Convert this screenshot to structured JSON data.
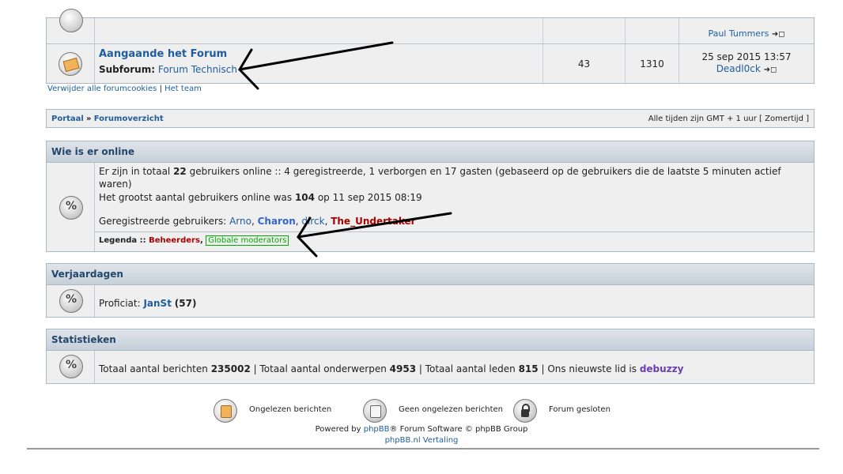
{
  "forum_table": {
    "row1": {
      "last_user": "Paul Tummers"
    },
    "row2": {
      "title": "Aangaande het Forum",
      "subforum_label": "Subforum:",
      "subforum_link": "Forum Technisch",
      "topics": "43",
      "posts": "1310",
      "last_date": "25 sep 2015 13:57",
      "last_user": "Deadl0ck"
    }
  },
  "links": {
    "delete_cookies": "Verwijder alle forumcookies",
    "sep": "|",
    "team": "Het team"
  },
  "breadcrumb": {
    "portal": "Portaal",
    "sep": "»",
    "overview": "Forumoverzicht",
    "timezone": "Alle tijden zijn GMT + 1 uur [ Zomertijd ]"
  },
  "online": {
    "header": "Wie is er online",
    "line1_a": "Er zijn in totaal ",
    "line1_num": "22",
    "line1_b": " gebruikers online :: 4 geregistreerde, 1 verborgen en 17 gasten (gebaseerd op de gebruikers die de laatste 5 minuten actief",
    "line2": "waren)",
    "line3_a": "Het grootst aantal gebruikers online was ",
    "line3_num": "104",
    "line3_b": " op 11 sep 2015 08:19",
    "registered_label": "Geregistreerde gebruikers: ",
    "users": [
      "Arno",
      "Charon",
      "dirck",
      "The_Undertaker"
    ],
    "legend_label": "Legenda :: ",
    "legend_admins": "Beheerders",
    "legend_mods": "Globale moderators"
  },
  "birthdays": {
    "header": "Verjaardagen",
    "text": "Proficiat: ",
    "user": "JanSt",
    "age": "(57)"
  },
  "stats": {
    "header": "Statistieken",
    "a": "Totaal aantal berichten ",
    "posts": "235002",
    "b": " | Totaal aantal onderwerpen ",
    "topics": "4953",
    "c": " | Totaal aantal leden ",
    "members": "815",
    "d": " | Ons nieuwste lid is ",
    "newest": "debuzzy"
  },
  "legend_icons": {
    "unread": "Ongelezen berichten",
    "no_unread": "Geen ongelezen berichten",
    "locked": "Forum gesloten"
  },
  "footer": {
    "powered_a": "Powered by ",
    "phpbb": "phpBB",
    "powered_b": "® Forum Software © phpBB Group",
    "translation": "phpBB.nl Vertaling"
  },
  "colors": {
    "admin": "#aa0000",
    "moderator": "#00aa00",
    "link": "#1f5d9c"
  }
}
